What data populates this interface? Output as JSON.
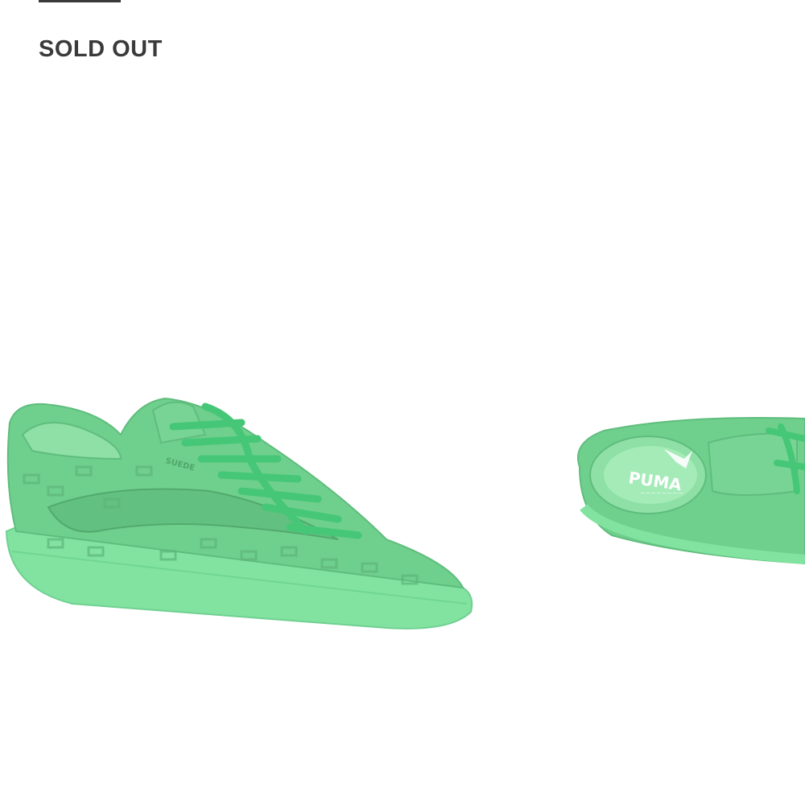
{
  "product": {
    "status_label": "SOLD OUT",
    "sole_logo_text": "PUMA",
    "side_stamp_text": "SUEDE",
    "colors": {
      "upper": "#6fcf8c",
      "upper_dark": "#57b373",
      "sole": "#82e3a0",
      "lace": "#45c777",
      "text": "#3a3a3a"
    }
  },
  "gallery": {
    "images": [
      {
        "view": "side view",
        "icon": "sneaker-side-image"
      },
      {
        "view": "top view",
        "icon": "sneaker-top-image"
      }
    ]
  }
}
